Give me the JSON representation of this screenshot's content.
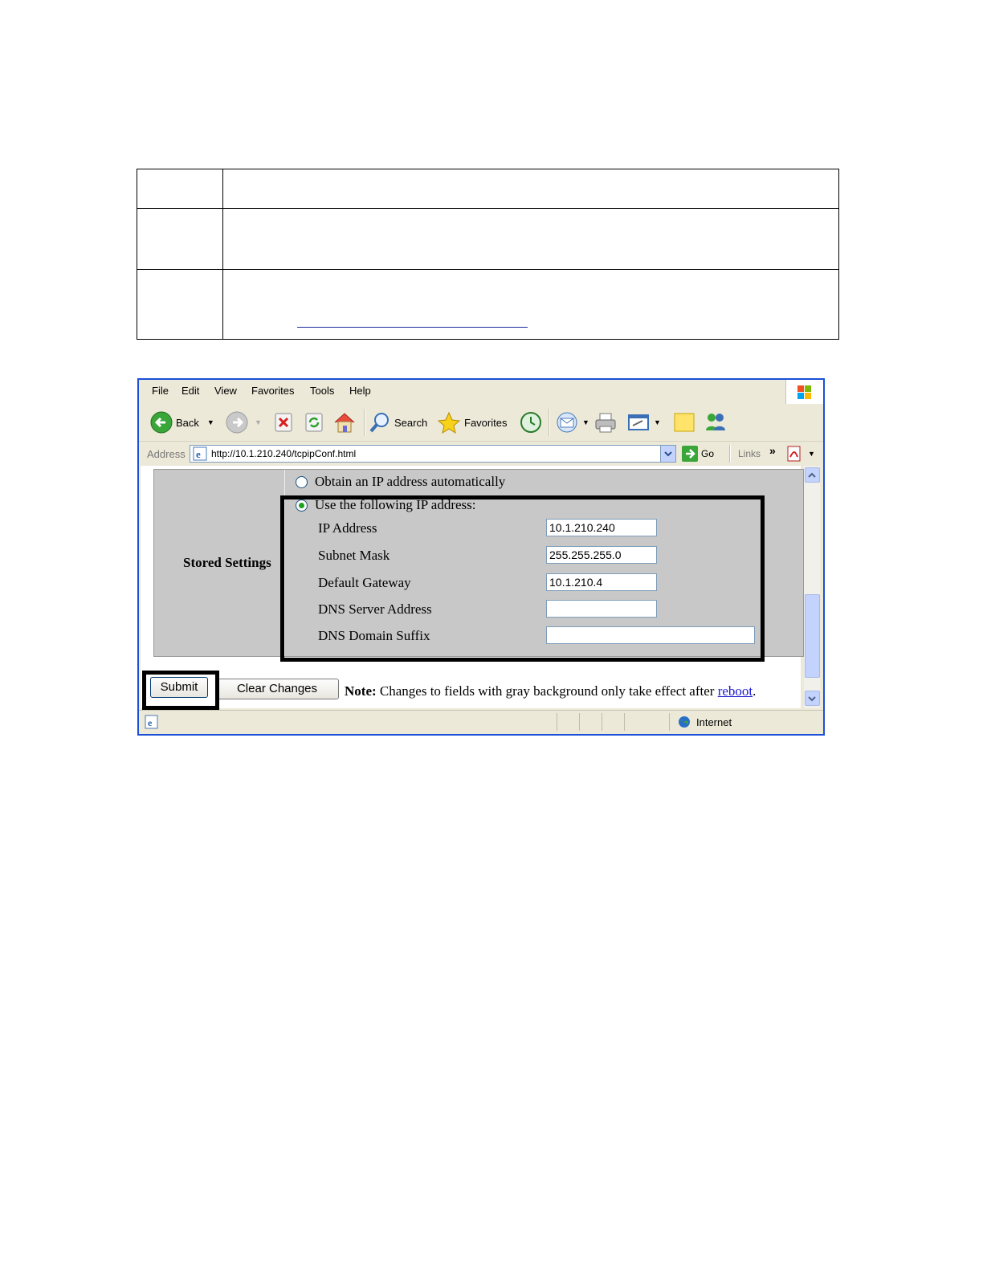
{
  "browser": {
    "menu": [
      "File",
      "Edit",
      "View",
      "Favorites",
      "Tools",
      "Help"
    ],
    "toolbar": {
      "back_label": "Back",
      "search_label": "Search",
      "favorites_label": "Favorites"
    },
    "address_label": "Address",
    "url": "http://10.1.210.240/tcpipConf.html",
    "go_label": "Go",
    "links_label": "Links",
    "status_zone": "Internet"
  },
  "form": {
    "section_label": "Stored Settings",
    "radio_auto": "Obtain an IP address automatically",
    "radio_manual": "Use the following IP address:",
    "selected_option": "manual",
    "fields": [
      {
        "label": "IP Address",
        "value": "10.1.210.240"
      },
      {
        "label": "Subnet Mask",
        "value": "255.255.255.0"
      },
      {
        "label": "Default Gateway",
        "value": "10.1.210.4"
      },
      {
        "label": "DNS Server Address",
        "value": ""
      },
      {
        "label": "DNS Domain Suffix",
        "value": ""
      }
    ],
    "submit_label": "Submit",
    "clear_label": "Clear Changes",
    "note_bold": "Note:",
    "note_text": " Changes to fields with gray background only take effect after ",
    "note_link": "reboot",
    "note_end": "."
  },
  "colors": {
    "window_border": "#1b4fd8",
    "panel_gray": "#c8c8c8",
    "link_blue": "#1a1ad0"
  }
}
